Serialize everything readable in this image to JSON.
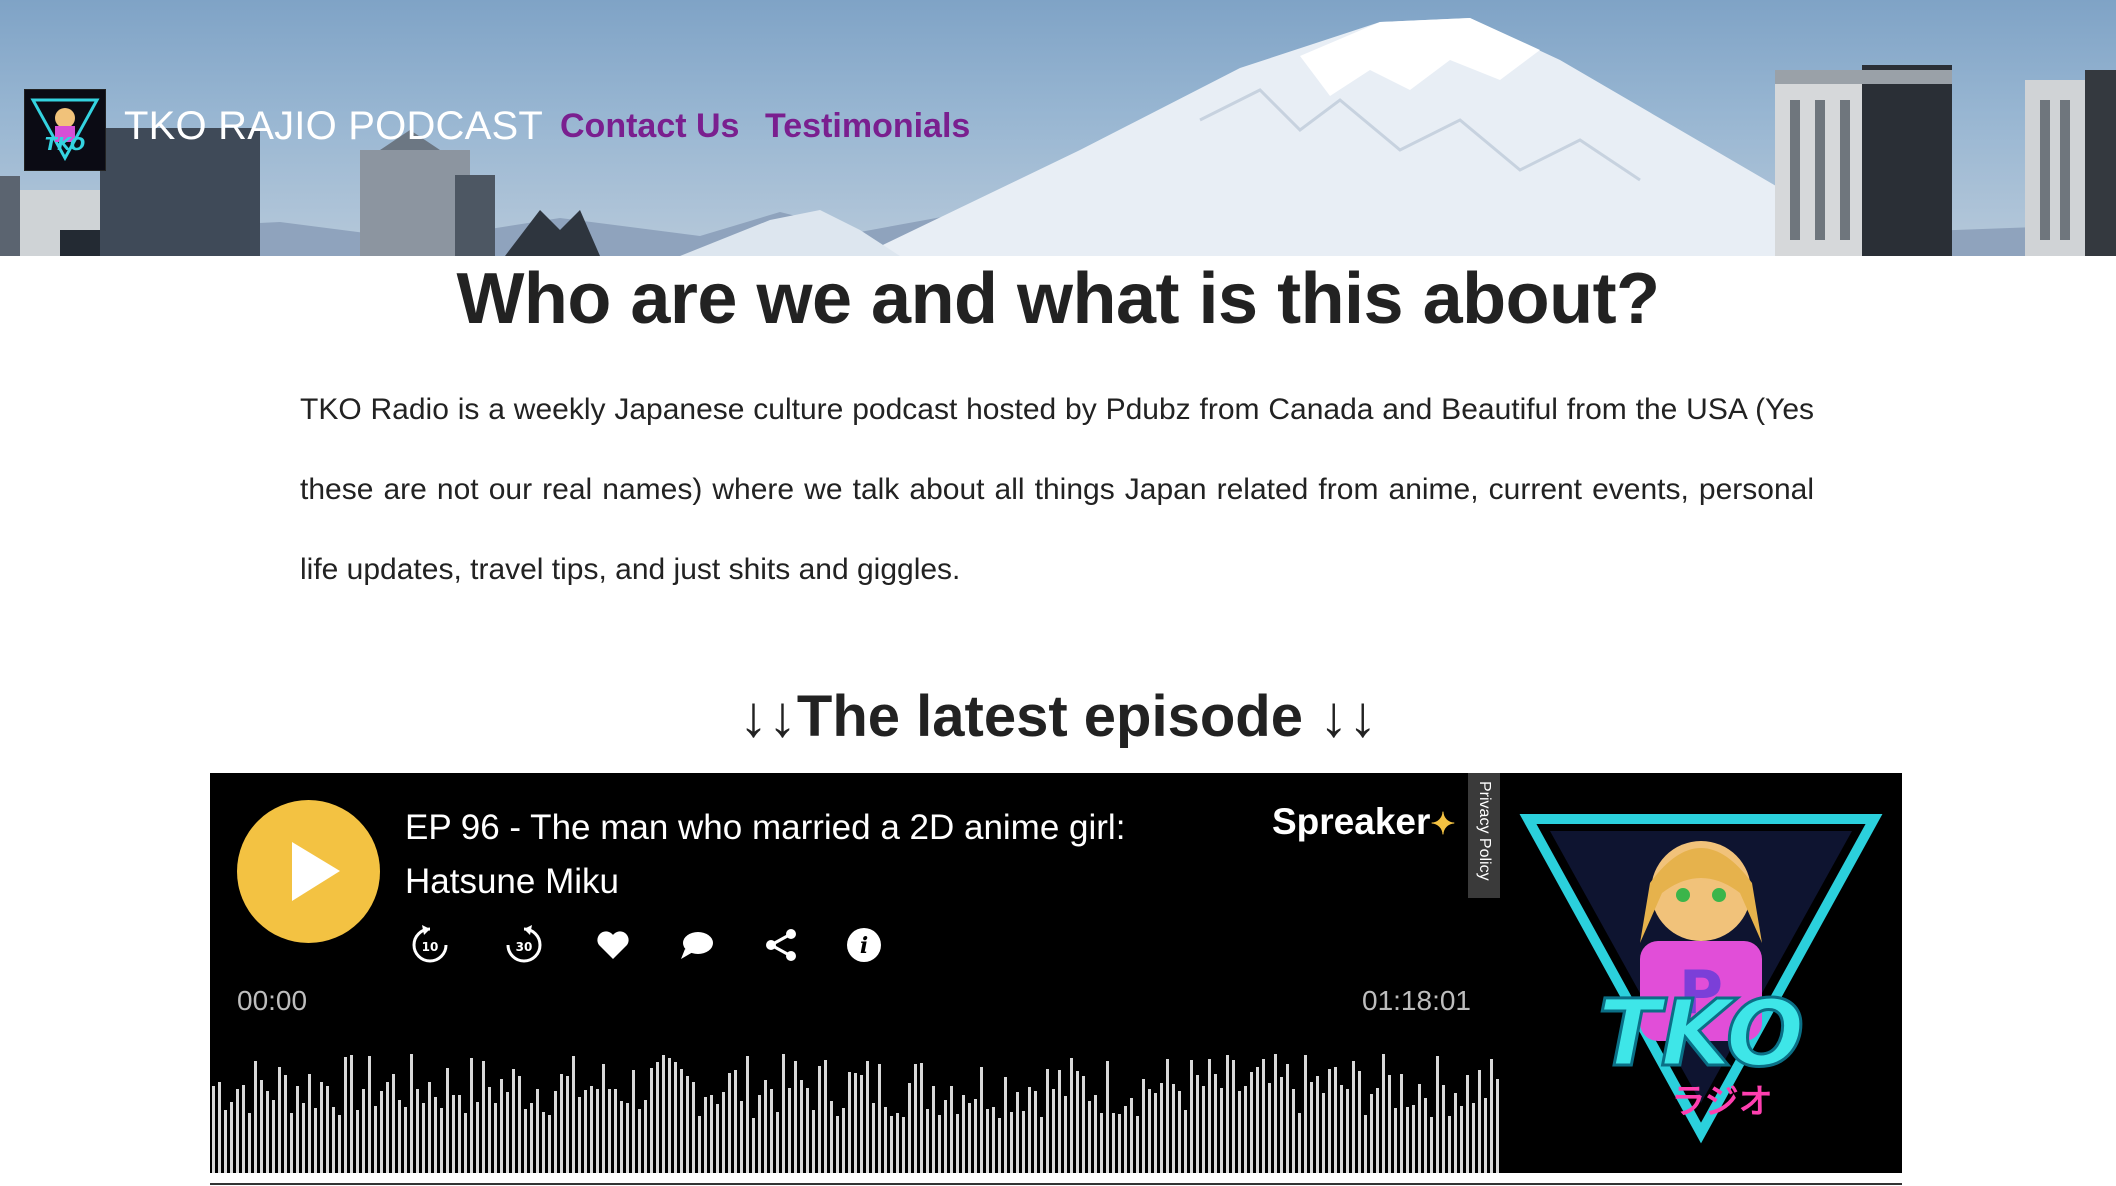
{
  "header": {
    "site_title": "TKO RAJIO PODCAST",
    "nav": [
      {
        "label": "Contact Us"
      },
      {
        "label": "Testimonials"
      }
    ],
    "logo_text": "TKO",
    "link_color": "#7a1f8f"
  },
  "main": {
    "title": "Who are we and what is this about?",
    "intro": "TKO Radio is a weekly Japanese culture podcast hosted by Pdubz from Canada and Beautiful from the USA (Yes these are not our real names) where we talk about all things Japan related from anime, current events, personal life updates, travel tips, and just shits and giggles.",
    "latest_heading": "↓↓The latest episode ↓↓"
  },
  "player": {
    "episode_title": "EP 96 - The man who married a 2D anime girl: Hatsune Miku",
    "brand": "Spreaker",
    "privacy_label": "Privacy Policy",
    "current_time": "00:00",
    "duration": "01:18:01",
    "controls": [
      "rewind-10-icon",
      "forward-30-icon",
      "heart-icon",
      "comment-icon",
      "share-icon",
      "info-icon"
    ],
    "play_color": "#f3c242",
    "cover_text": "TKO",
    "cover_subtext": "ラジオ"
  }
}
